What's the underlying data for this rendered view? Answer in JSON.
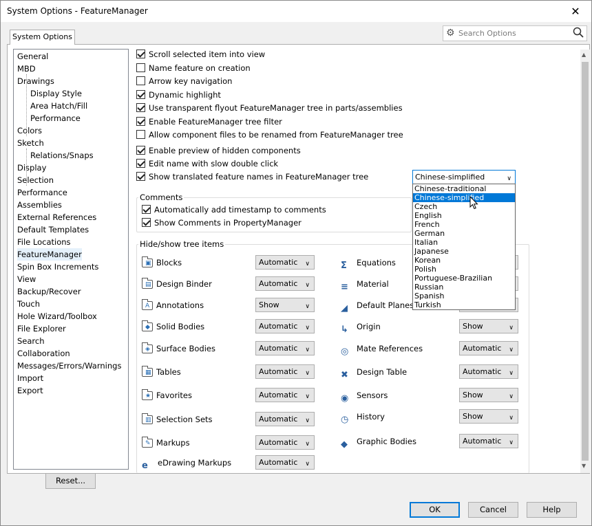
{
  "window": {
    "title": "System Options - FeatureManager",
    "close": "✕"
  },
  "tab": "System Options",
  "search": {
    "placeholder": "Search Options"
  },
  "nav": {
    "items": [
      "General",
      "MBD",
      "Drawings",
      "Display Style",
      "Area Hatch/Fill",
      "Performance",
      "Colors",
      "Sketch",
      "Relations/Snaps",
      "Display",
      "Selection",
      "Performance",
      "Assemblies",
      "External References",
      "Default Templates",
      "File Locations",
      "FeatureManager",
      "Spin Box Increments",
      "View",
      "Backup/Recover",
      "Touch",
      "Hole Wizard/Toolbox",
      "File Explorer",
      "Search",
      "Collaboration",
      "Messages/Errors/Warnings",
      "Import",
      "Export"
    ],
    "selected": "FeatureManager"
  },
  "options": [
    {
      "label": "Scroll selected item into view",
      "checked": true
    },
    {
      "label": "Name feature on creation",
      "checked": false
    },
    {
      "label": "Arrow key navigation",
      "checked": false
    },
    {
      "label": "Dynamic highlight",
      "checked": true
    },
    {
      "label": "Use transparent flyout FeatureManager tree in parts/assemblies",
      "checked": true
    },
    {
      "label": "Enable FeatureManager tree filter",
      "checked": true
    },
    {
      "label": "Allow component files to be renamed from FeatureManager tree",
      "checked": false
    },
    {
      "label": "Enable preview of hidden components",
      "checked": true
    },
    {
      "label": "Edit name with slow double click",
      "checked": true
    },
    {
      "label": "Show translated feature names in FeatureManager tree",
      "checked": true
    }
  ],
  "language": {
    "selected": "Chinese-simplified",
    "options": [
      "Chinese-traditional",
      "Chinese-simplified",
      "Czech",
      "English",
      "French",
      "German",
      "Italian",
      "Japanese",
      "Korean",
      "Polish",
      "Portuguese-Brazilian",
      "Russian",
      "Spanish",
      "Turkish"
    ],
    "highlighted": "Chinese-simplified"
  },
  "comments": {
    "legend": "Comments",
    "items": [
      {
        "label": "Automatically add timestamp to comments",
        "checked": true
      },
      {
        "label": "Show Comments in PropertyManager",
        "checked": true
      }
    ]
  },
  "tree": {
    "legend": "Hide/show tree items",
    "left": [
      {
        "label": "Blocks",
        "value": "Automatic",
        "icon": "blocks-icon"
      },
      {
        "label": "Design Binder",
        "value": "Automatic",
        "icon": "design-binder-icon"
      },
      {
        "label": "Annotations",
        "value": "Show",
        "icon": "annotations-icon"
      },
      {
        "label": "Solid Bodies",
        "value": "Automatic",
        "icon": "solid-bodies-icon"
      },
      {
        "label": "Surface Bodies",
        "value": "Automatic",
        "icon": "surface-bodies-icon"
      },
      {
        "label": "Tables",
        "value": "Automatic",
        "icon": "tables-icon"
      },
      {
        "label": "Favorites",
        "value": "Automatic",
        "icon": "favorites-icon"
      },
      {
        "label": "Selection Sets",
        "value": "Automatic",
        "icon": "selection-sets-icon"
      },
      {
        "label": "Markups",
        "value": "Automatic",
        "icon": "markups-icon"
      },
      {
        "label": "eDrawing Markups",
        "value": "Automatic",
        "icon": "edrawing-markups-icon"
      }
    ],
    "right": [
      {
        "label": "Equations",
        "value": "",
        "icon": "equations-icon"
      },
      {
        "label": "Material",
        "value": "",
        "icon": "material-icon"
      },
      {
        "label": "Default Planes",
        "value": "",
        "icon": "default-planes-icon"
      },
      {
        "label": "Origin",
        "value": "Show",
        "icon": "origin-icon"
      },
      {
        "label": "Mate References",
        "value": "Automatic",
        "icon": "mate-references-icon"
      },
      {
        "label": "Design Table",
        "value": "Automatic",
        "icon": "design-table-icon"
      },
      {
        "label": "Sensors",
        "value": "Show",
        "icon": "sensors-icon"
      },
      {
        "label": "History",
        "value": "Show",
        "icon": "history-icon"
      },
      {
        "label": "Graphic Bodies",
        "value": "Automatic",
        "icon": "graphic-bodies-icon"
      }
    ]
  },
  "buttons": {
    "reset": "Reset...",
    "ok": "OK",
    "cancel": "Cancel",
    "help": "Help"
  }
}
